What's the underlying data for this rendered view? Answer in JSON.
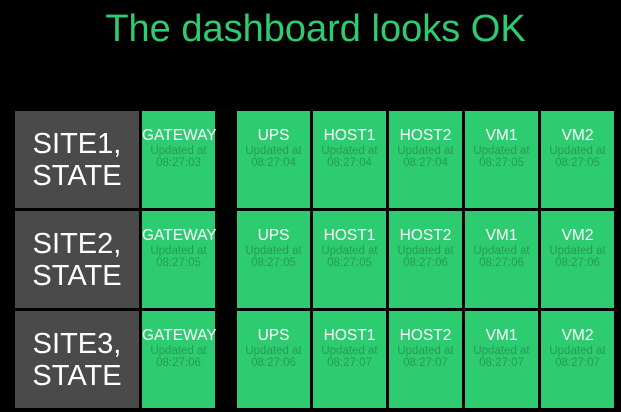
{
  "header": {
    "title": "The dashboard looks OK"
  },
  "colors": {
    "background": "#000000",
    "tile_ok": "#2ecc71",
    "tile_text": "#ffffff",
    "tile_subtext": "#249c56",
    "site_label_bg": "#4a4a4a",
    "title": "#2ecc71"
  },
  "sites": [
    {
      "label_line1": "SITE1,",
      "label_line2": "STATE",
      "tiles": [
        {
          "name": "GATEWAY",
          "updated_label": "Updated at",
          "time": "08:27:03"
        },
        {
          "name": "UPS",
          "updated_label": "Updated at",
          "time": "08:27:04"
        },
        {
          "name": "HOST1",
          "updated_label": "Updated at",
          "time": "08:27:04"
        },
        {
          "name": "HOST2",
          "updated_label": "Updated at",
          "time": "08:27:04"
        },
        {
          "name": "VM1",
          "updated_label": "Updated at",
          "time": "08:27:05"
        },
        {
          "name": "VM2",
          "updated_label": "Updated at",
          "time": "08:27:05"
        }
      ]
    },
    {
      "label_line1": "SITE2,",
      "label_line2": "STATE",
      "tiles": [
        {
          "name": "GATEWAY",
          "updated_label": "Updated at",
          "time": "08:27:05"
        },
        {
          "name": "UPS",
          "updated_label": "Updated at",
          "time": "08:27:05"
        },
        {
          "name": "HOST1",
          "updated_label": "Updated at",
          "time": "08:27:05"
        },
        {
          "name": "HOST2",
          "updated_label": "Updated at",
          "time": "08:27:06"
        },
        {
          "name": "VM1",
          "updated_label": "Updated at",
          "time": "08:27:06"
        },
        {
          "name": "VM2",
          "updated_label": "Updated at",
          "time": "08:27:06"
        }
      ]
    },
    {
      "label_line1": "SITE3,",
      "label_line2": "STATE",
      "tiles": [
        {
          "name": "GATEWAY",
          "updated_label": "Updated at",
          "time": "08:27:06"
        },
        {
          "name": "UPS",
          "updated_label": "Updated at",
          "time": "08:27:06"
        },
        {
          "name": "HOST1",
          "updated_label": "Updated at",
          "time": "08:27:07"
        },
        {
          "name": "HOST2",
          "updated_label": "Updated at",
          "time": "08:27:07"
        },
        {
          "name": "VM1",
          "updated_label": "Updated at",
          "time": "08:27:07"
        },
        {
          "name": "VM2",
          "updated_label": "Updated at",
          "time": "08:27:07"
        }
      ]
    }
  ]
}
